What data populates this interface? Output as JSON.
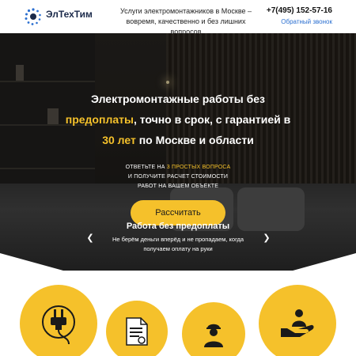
{
  "header": {
    "logo_text": "ЭлТехТим",
    "tagline": "Услуги электромонтажников в Москве – вовремя, качественно и без лишних вопросов",
    "phone": "+7(495) 152-57-16",
    "callback_label": "Обратный звонок"
  },
  "hero": {
    "headline_part1": "Электромонтажные работы без",
    "headline_highlight1": "предоплаты",
    "headline_part2": ", точно в срок, с гарантией в",
    "headline_highlight2": "30 лет",
    "headline_part3": " по Москве и области",
    "question_prefix": "ОТВЕТЬТЕ НА ",
    "question_highlight": "3 ПРОСТЫХ ВОПРОСА",
    "question_line2": "И ПОЛУЧИТЕ РАСЧЕТ СТОИМОСТИ",
    "question_line3": "РАБОТ НА ВАШЕМ ОБЪЕКТЕ",
    "cta_label": "Рассчитать"
  },
  "slider": {
    "title": "Работа без предоплаты",
    "text": "Не берём деньги вперёд и не пропадаем, когда получаем оплату на руки",
    "prev_icon": "chevron-left-icon",
    "next_icon": "chevron-right-icon"
  },
  "features": {
    "icons": [
      "plug-icon",
      "document-icon",
      "worker-icon",
      "hand-person-icon"
    ]
  },
  "colors": {
    "accent": "#f5c12b",
    "link": "#2b6fd0",
    "brand_dark": "#1b2a4a"
  }
}
